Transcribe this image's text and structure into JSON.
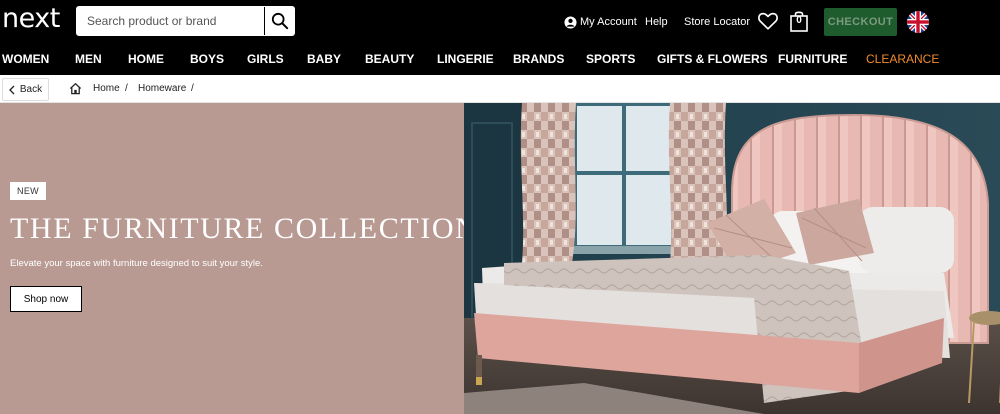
{
  "header": {
    "logo": "next",
    "search": {
      "placeholder": "Search product or brand"
    },
    "my_account": "My Account",
    "help": "Help",
    "store_locator": "Store Locator",
    "bag_count": "0",
    "checkout": "CHECKOUT"
  },
  "nav": {
    "items": [
      "WOMEN",
      "MEN",
      "HOME",
      "BOYS",
      "GIRLS",
      "BABY",
      "BEAUTY",
      "LINGERIE",
      "BRANDS",
      "SPORTS",
      "GIFTS & FLOWERS",
      "FURNITURE",
      "CLEARANCE"
    ]
  },
  "breadcrumb": {
    "back": "Back",
    "items": [
      "Home",
      "Homeware"
    ],
    "separator": "/"
  },
  "hero": {
    "badge": "NEW",
    "title": "THE FURNITURE COLLECTION",
    "subtitle": "Elevate your space with furniture designed to suit your style.",
    "cta": "Shop now"
  },
  "colors": {
    "header_bg": "#000000",
    "checkout_bg": "#1e5b2d",
    "clearance": "#f18a2c",
    "hero_panel": "#b99a93"
  },
  "icons": [
    "search-icon",
    "account-icon",
    "heart-icon",
    "bag-icon",
    "uk-flag-icon",
    "chevron-left-icon",
    "home-icon"
  ]
}
